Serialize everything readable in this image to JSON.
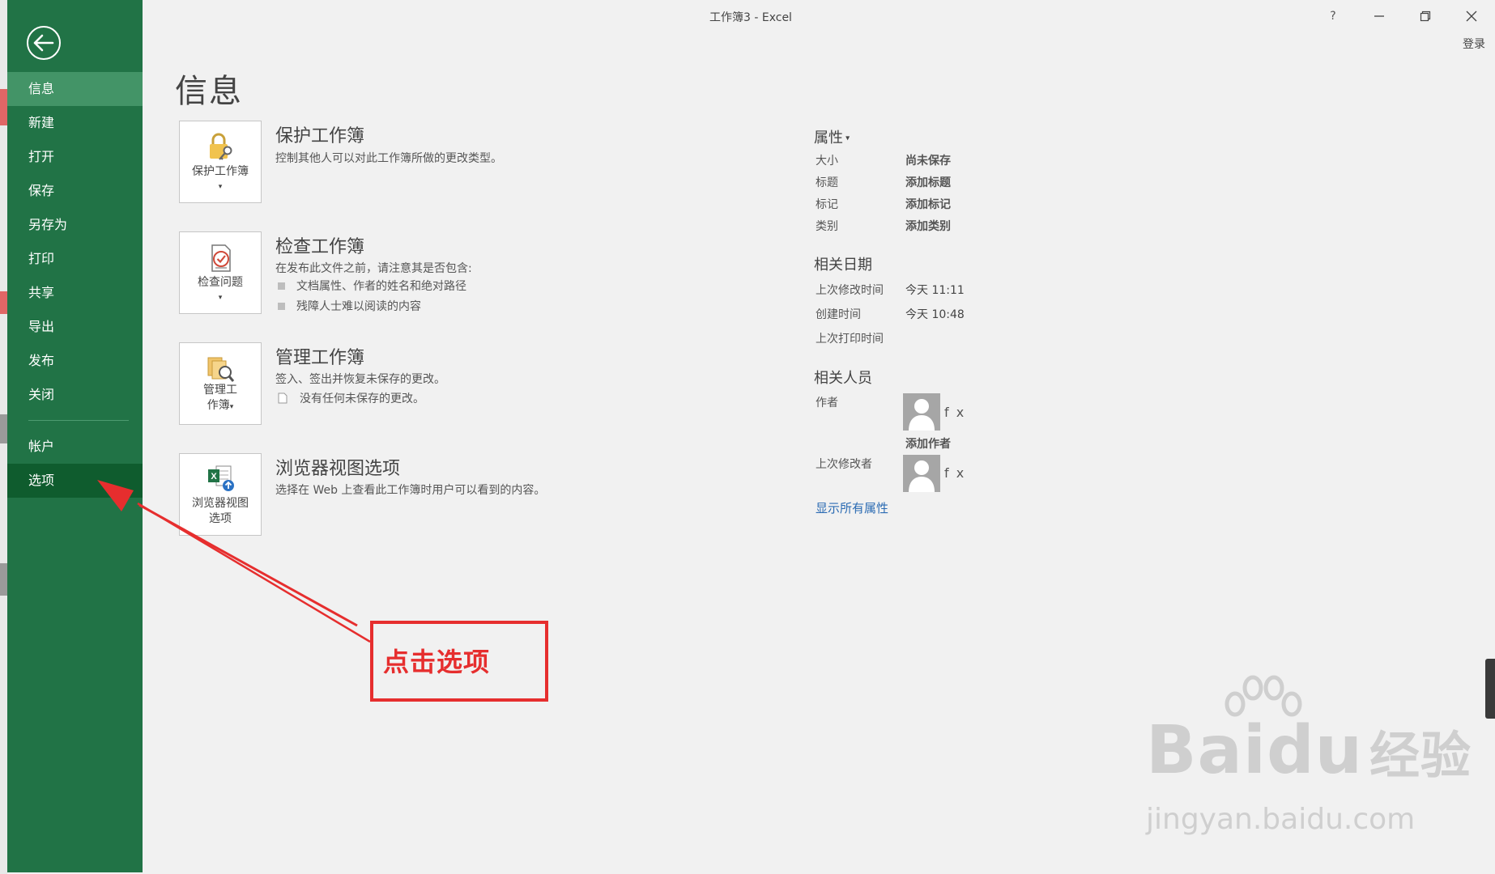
{
  "window": {
    "title": "工作簿3 - Excel",
    "help_label": "?",
    "signin_label": "登录"
  },
  "sidebar": {
    "items": [
      {
        "label": "信息"
      },
      {
        "label": "新建"
      },
      {
        "label": "打开"
      },
      {
        "label": "保存"
      },
      {
        "label": "另存为"
      },
      {
        "label": "打印"
      },
      {
        "label": "共享"
      },
      {
        "label": "导出"
      },
      {
        "label": "发布"
      },
      {
        "label": "关闭"
      },
      {
        "label": "帐户"
      },
      {
        "label": "选项"
      }
    ]
  },
  "page": {
    "heading": "信息"
  },
  "cards": [
    {
      "button_label": "保护工作簿",
      "title": "保护工作簿",
      "description": "控制其他人可以对此工作簿所做的更改类型。"
    },
    {
      "button_label": "检查问题",
      "title": "检查工作簿",
      "description": "在发布此文件之前，请注意其是否包含:",
      "bullets": [
        "文档属性、作者的姓名和绝对路径",
        "残障人士难以阅读的内容"
      ]
    },
    {
      "button_label_1": "管理工",
      "button_label_2": "作簿",
      "title": "管理工作簿",
      "description": "签入、签出并恢复未保存的更改。",
      "note": "没有任何未保存的更改。"
    },
    {
      "button_label_1": "浏览器视图",
      "button_label_2": "选项",
      "title": "浏览器视图选项",
      "description": "选择在 Web 上查看此工作簿时用户可以看到的内容。"
    }
  ],
  "properties": {
    "heading": "属性",
    "rows": [
      {
        "label": "大小",
        "value": "尚未保存"
      },
      {
        "label": "标题",
        "value": "添加标题"
      },
      {
        "label": "标记",
        "value": "添加标记"
      },
      {
        "label": "类别",
        "value": "添加类别"
      }
    ]
  },
  "dates": {
    "heading": "相关日期",
    "rows": [
      {
        "label": "上次修改时间",
        "value": "今天 11:11"
      },
      {
        "label": "创建时间",
        "value": "今天 10:48"
      },
      {
        "label": "上次打印时间",
        "value": ""
      }
    ]
  },
  "people": {
    "heading": "相关人员",
    "author_label": "作者",
    "author_name": "f x",
    "add_author": "添加作者",
    "last_modified_label": "上次修改者",
    "last_modified_name": "f x",
    "show_all": "显示所有属性"
  },
  "annotation": {
    "text": "点击选项",
    "color": "#e62e2e"
  },
  "watermark": {
    "brand": "Bai",
    "brand_tail": "du",
    "brand_cn": "经验",
    "sub": "jingyan.baidu.com"
  },
  "colors": {
    "sidebar": "#217346",
    "sidebar_active": "#439467",
    "sidebar_selected": "#0f5c2e",
    "background": "#f1f1f1",
    "link": "#2b6bb3"
  }
}
